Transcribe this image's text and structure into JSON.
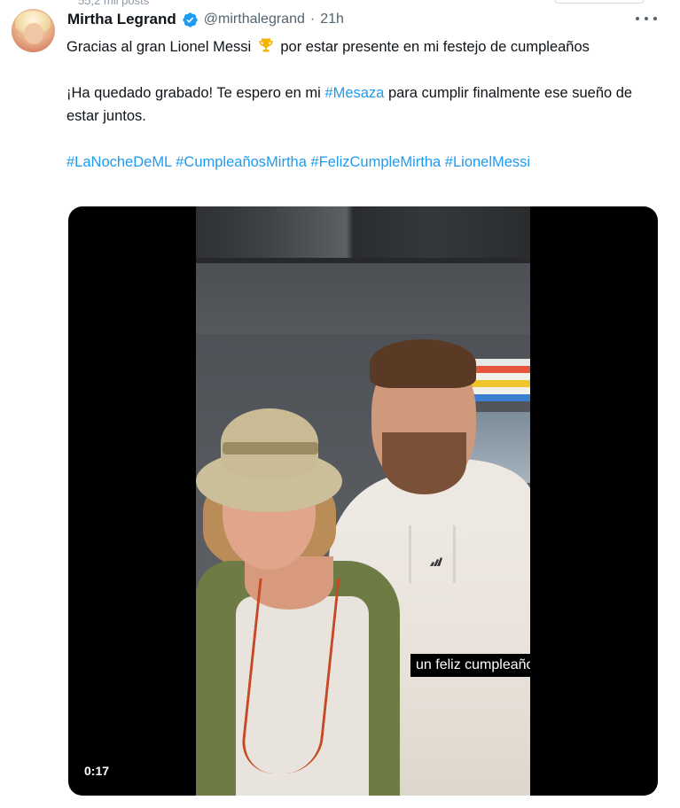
{
  "header": {
    "truncated_text": "55,2 mil posts"
  },
  "tweet": {
    "display_name": "Mirtha Legrand",
    "handle": "@mirthalegrand",
    "separator": "·",
    "time": "21h",
    "line1_before": "Gracias al gran Lionel Messi",
    "line1_after": "por estar presente en mi festejo de cumpleaños",
    "para2_before": "¡Ha quedado grabado! Te espero en mi",
    "para2_hashtag": "#Mesaza",
    "para2_after": "para cumplir finalmente ese sueño de estar juntos.",
    "hashtags": [
      "#LaNocheDeML",
      "#CumpleañosMirtha",
      "#FelizCumpleMirtha",
      "#LionelMessi"
    ]
  },
  "video": {
    "caption": "un feliz cumpleaños",
    "duration": "0:17"
  },
  "icons": {
    "verified": "verified-badge-icon",
    "more": "more-icon",
    "trophy": "trophy-emoji-icon"
  },
  "colors": {
    "link": "#1d9bf0",
    "verified": "#1d9bf0",
    "text": "#0f1419",
    "secondary": "#536471"
  }
}
